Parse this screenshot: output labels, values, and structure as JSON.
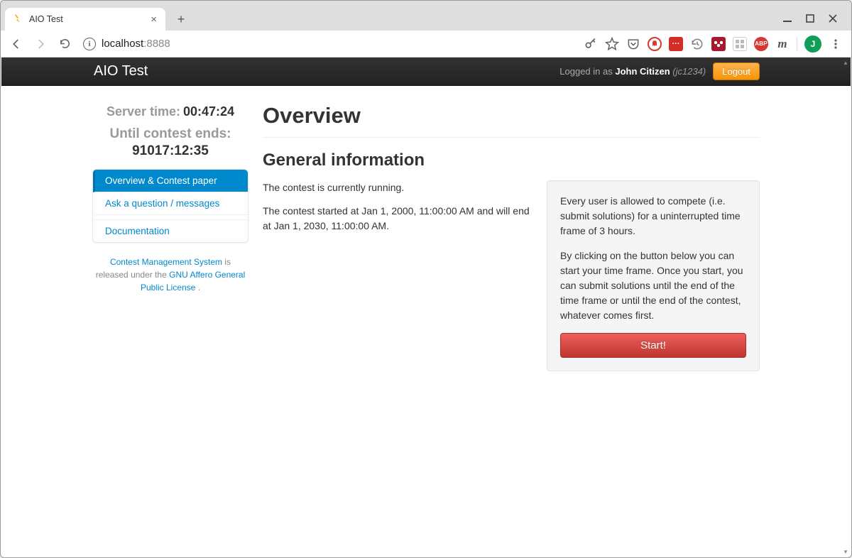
{
  "browser": {
    "tab_title": "AIO Test",
    "url_host": "localhost",
    "url_port": ":8888",
    "avatar_letter": "J",
    "ext_icons": [
      "key",
      "star",
      "pocket",
      "ghostery",
      "lastpass",
      "history",
      "mendeley",
      "grid",
      "abp",
      "m"
    ]
  },
  "navbar": {
    "brand": "AIO Test",
    "logged_in_prefix": "Logged in as ",
    "user_name": "John Citizen",
    "user_handle": "(jc1234)",
    "logout": "Logout"
  },
  "sidebar": {
    "server_time_label": "Server time:",
    "server_time_value": "00:47:24",
    "until_label": "Until contest ends:",
    "until_value": "91017:12:35",
    "items": [
      "Overview & Contest paper",
      "Ask a question / messages",
      "Documentation"
    ],
    "credits_1": " is released under the ",
    "credits_link1": "Contest Management System",
    "credits_link2": "GNU Affero General Public License",
    "credits_tail": " ."
  },
  "main": {
    "h1": "Overview",
    "h2": "General information",
    "p1": "The contest is currently running.",
    "p2": "The contest started at Jan 1, 2000, 11:00:00 AM and will end at Jan 1, 2030, 11:00:00 AM.",
    "well_p1": "Every user is allowed to compete (i.e. submit solutions) for a uninterrupted time frame of 3 hours.",
    "well_p2": "By clicking on the button below you can start your time frame. Once you start, you can submit solutions until the end of the time frame or until the end of the contest, whatever comes first.",
    "start": "Start!"
  }
}
